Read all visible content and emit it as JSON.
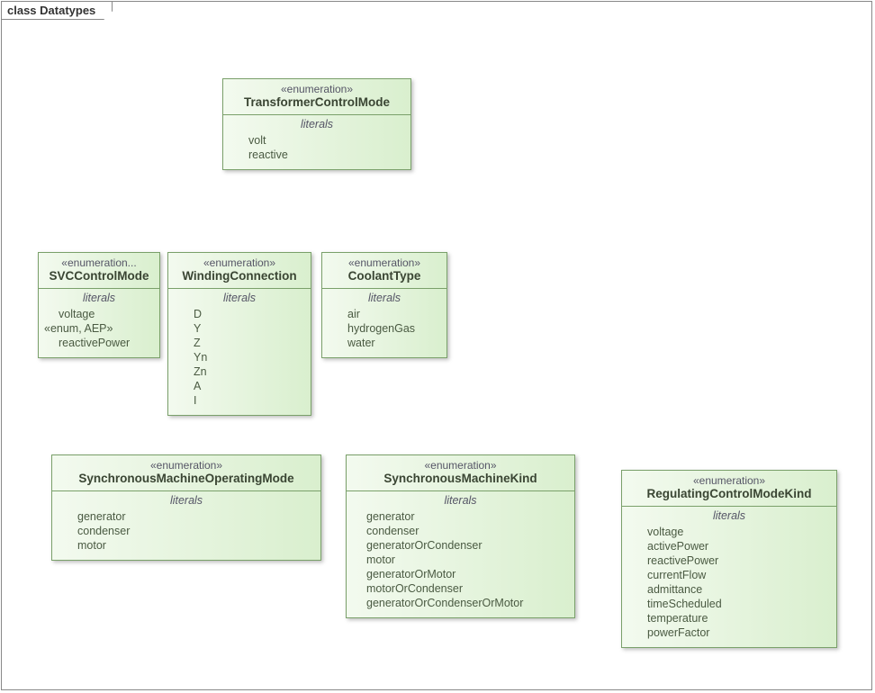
{
  "frame": {
    "label": "class Datatypes"
  },
  "boxes": {
    "transformerControlMode": {
      "stereotype": "«enumeration»",
      "name": "TransformerControlMode",
      "section": "literals",
      "items": [
        "volt",
        "reactive"
      ]
    },
    "svcControlMode": {
      "stereotype": "«enumeration...",
      "name": "SVCControlMode",
      "section": "literals",
      "items1": [
        "voltage"
      ],
      "subStereo": "«enum, AEP»",
      "items2": [
        "reactivePower"
      ]
    },
    "windingConnection": {
      "stereotype": "«enumeration»",
      "name": "WindingConnection",
      "section": "literals",
      "items": [
        "D",
        "Y",
        "Z",
        "Yn",
        "Zn",
        "A",
        "I"
      ]
    },
    "coolantType": {
      "stereotype": "«enumeration»",
      "name": "CoolantType",
      "section": "literals",
      "items": [
        "air",
        "hydrogenGas",
        "water"
      ]
    },
    "syncMachineOperatingMode": {
      "stereotype": "«enumeration»",
      "name": "SynchronousMachineOperatingMode",
      "section": "literals",
      "items": [
        "generator",
        "condenser",
        "motor"
      ]
    },
    "syncMachineKind": {
      "stereotype": "«enumeration»",
      "name": "SynchronousMachineKind",
      "section": "literals",
      "items": [
        "generator",
        "condenser",
        "generatorOrCondenser",
        "motor",
        "generatorOrMotor",
        "motorOrCondenser",
        "generatorOrCondenserOrMotor"
      ]
    },
    "regulatingControlModeKind": {
      "stereotype": "«enumeration»",
      "name": "RegulatingControlModeKind",
      "section": "literals",
      "items": [
        "voltage",
        "activePower",
        "reactivePower",
        "currentFlow",
        "admittance",
        "timeScheduled",
        "temperature",
        "powerFactor"
      ]
    }
  }
}
